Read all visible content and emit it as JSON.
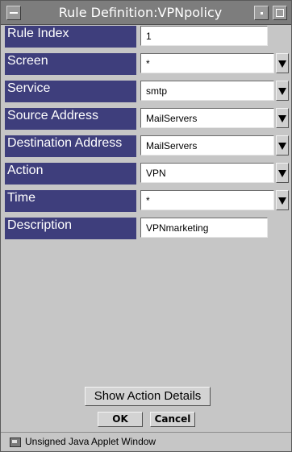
{
  "window": {
    "title": "Rule Definition:VPNpolicy"
  },
  "form": {
    "rows": [
      {
        "label": "Rule Index",
        "value": "1",
        "control": "text"
      },
      {
        "label": "Screen",
        "value": "*",
        "control": "dropdown"
      },
      {
        "label": "Service",
        "value": "smtp",
        "control": "dropdown"
      },
      {
        "label": "Source Address",
        "value": "MailServers",
        "control": "dropdown"
      },
      {
        "label": "Destination Address",
        "value": "MailServers",
        "control": "dropdown"
      },
      {
        "label": "Action",
        "value": "VPN",
        "control": "dropdown"
      },
      {
        "label": "Time",
        "value": "*",
        "control": "dropdown"
      },
      {
        "label": "Description",
        "value": "VPNmarketing",
        "control": "text"
      }
    ]
  },
  "buttons": {
    "show_details": "Show Action Details",
    "ok": "OK",
    "cancel": "Cancel"
  },
  "status": {
    "text": "Unsigned Java Applet Window"
  },
  "icons": {
    "window_menu": "window-menu-icon",
    "minimize": "minimize-icon",
    "maximize": "maximize-icon",
    "dropdown": "triangle-down-icon",
    "applet": "java-applet-icon"
  }
}
